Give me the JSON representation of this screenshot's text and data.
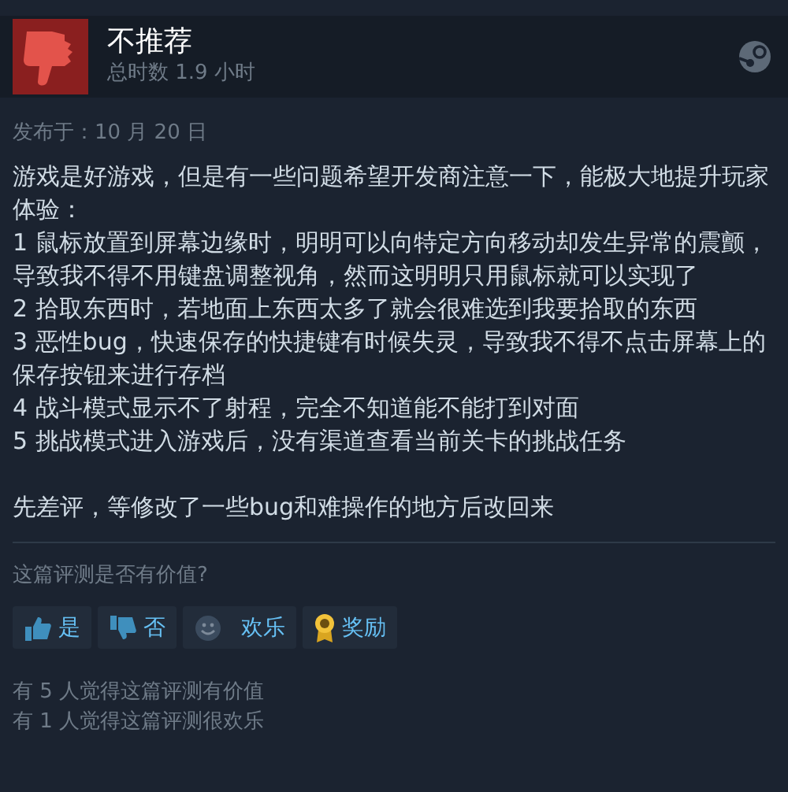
{
  "review": {
    "verdict": "不推荐",
    "playtime": "总时数 1.9 小时",
    "posted": "发布于：10 月 20 日",
    "paragraphs": [
      "游戏是好游戏，但是有一些问题希望开发商注意一下，能极大地提升玩家体验：",
      "1 鼠标放置到屏幕边缘时，明明可以向特定方向移动却发生异常的震颤，导致我不得不用键盘调整视角，然而这明明只用鼠标就可以实现了",
      "2 拾取东西时，若地面上东西太多了就会很难选到我要拾取的东西",
      "3 恶性bug，快速保存的快捷键有时候失灵，导致我不得不点击屏幕上的保存按钮来进行存档",
      "4 战斗模式显示不了射程，完全不知道能不能打到对面",
      "5 挑战模式进入游戏后，没有渠道查看当前关卡的挑战任务",
      "先差评，等修改了一些bug和难操作的地方后改回来"
    ]
  },
  "helpful": {
    "question": "这篇评测是否有价值?",
    "buttons": [
      {
        "kind": "yes",
        "label": "是"
      },
      {
        "kind": "no",
        "label": "否"
      },
      {
        "kind": "funny",
        "label": "欢乐"
      },
      {
        "kind": "award",
        "label": "奖励"
      }
    ],
    "stats": [
      "有 5 人觉得这篇评测有价值",
      "有 1 人觉得这篇评测很欢乐"
    ]
  }
}
